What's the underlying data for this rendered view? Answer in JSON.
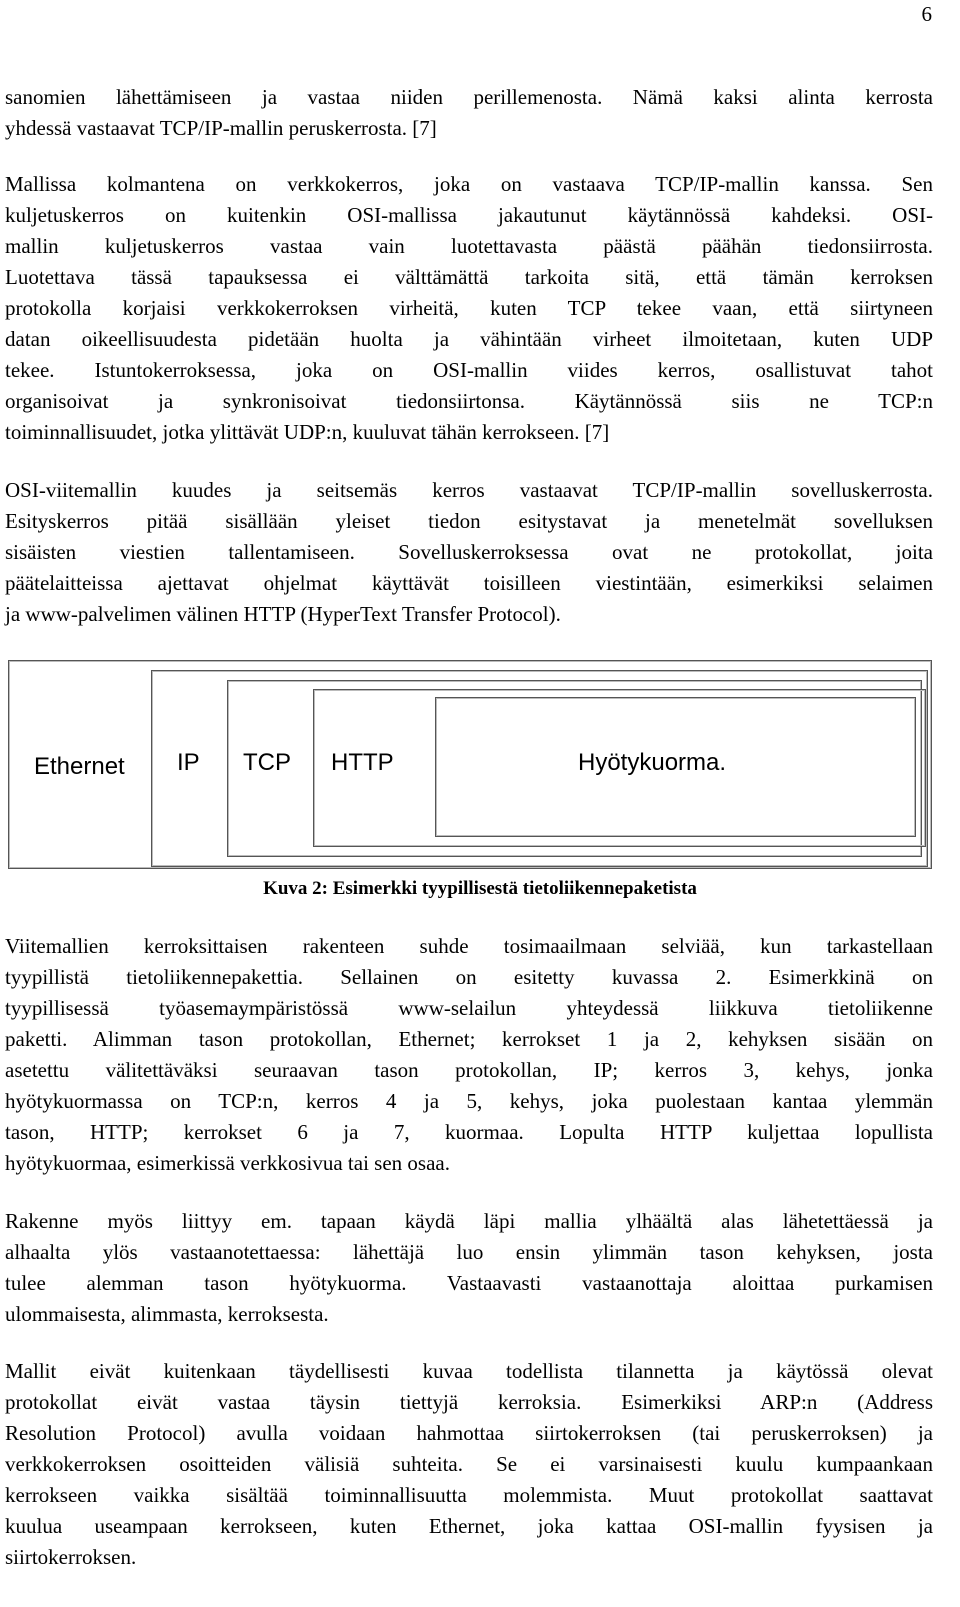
{
  "page_number": "6",
  "paragraphs": [
    {
      "lines": [
        "sanomien lähettämiseen ja vastaa niiden perillemenosta. Nämä kaksi alinta kerrosta",
        "yhdessä vastaavat TCP/IP-mallin peruskerrosta. [7]"
      ]
    },
    {
      "lines": [
        "Mallissa kolmantena on verkkokerros, joka on vastaava TCP/IP-mallin kanssa. Sen",
        "kuljetuskerros on kuitenkin OSI-mallissa jakautunut käytännössä kahdeksi. OSI-",
        "mallin kuljetuskerros vastaa vain luotettavasta päästä päähän tiedonsiirrosta.",
        "Luotettava tässä tapauksessa ei välttämättä tarkoita sitä, että tämän kerroksen",
        "protokolla korjaisi verkkokerroksen virheitä, kuten TCP tekee vaan, että siirtyneen",
        "datan oikeellisuudesta pidetään huolta ja vähintään virheet ilmoitetaan, kuten UDP",
        "tekee. Istuntokerroksessa, joka on OSI-mallin viides kerros, osallistuvat tahot",
        "organisoivat ja synkronisoivat tiedonsiirtonsa. Käytännössä siis ne TCP:n",
        "toiminnallisuudet, jotka ylittävät UDP:n, kuuluvat tähän kerrokseen. [7]"
      ]
    },
    {
      "lines": [
        "OSI-viitemallin kuudes ja seitsemäs kerros vastaavat TCP/IP-mallin sovelluskerrosta.",
        "Esityskerros pitää sisällään yleiset tiedon esitystavat ja menetelmät sovelluksen",
        "sisäisten viestien tallentamiseen. Sovelluskerroksessa ovat ne protokollat, joita",
        "päätelaitteissa ajettavat ohjelmat käyttävät toisilleen viestintään, esimerkiksi selaimen",
        "ja www-palvelimen välinen HTTP (HyperText Transfer Protocol)."
      ]
    },
    {
      "lines": [
        "Viitemallien kerroksittaisen rakenteen suhde tosimaailmaan selviää, kun tarkastellaan",
        "tyypillistä tietoliikennepakettia. Sellainen on esitetty kuvassa 2. Esimerkkinä on",
        "tyypillisessä työasemaympäristössä www-selailun yhteydessä liikkuva tietoliikenne",
        "paketti. Alimman tason protokollan, Ethernet; kerrokset 1 ja 2, kehyksen sisään on",
        "asetettu välitettäväksi seuraavan tason protokollan, IP; kerros 3, kehys, jonka",
        "hyötykuormassa on TCP:n, kerros 4 ja 5, kehys, joka puolestaan kantaa ylemmän",
        "tason, HTTP; kerrokset 6 ja 7, kuormaa. Lopulta HTTP kuljettaa lopullista",
        "hyötykuormaa, esimerkissä verkkosivua tai sen osaa."
      ]
    },
    {
      "lines": [
        " Rakenne myös liittyy em. tapaan käydä läpi mallia ylhäältä alas lähetettäessä ja",
        "alhaalta ylös vastaanotettaessa: lähettäjä luo ensin ylimmän tason kehyksen, josta",
        "tulee alemman tason hyötykuorma. Vastaavasti vastaanottaja aloittaa purkamisen",
        "ulommaisesta, alimmasta, kerroksesta."
      ]
    },
    {
      "lines": [
        "Mallit eivät kuitenkaan täydellisesti kuvaa todellista tilannetta ja käytössä olevat",
        "protokollat eivät vastaa täysin tiettyjä kerroksia. Esimerkiksi ARP:n (Address",
        "Resolution Protocol) avulla voidaan hahmottaa siirtokerroksen (tai peruskerroksen) ja",
        "verkkokerroksen osoitteiden välisiä suhteita. Se ei varsinaisesti kuulu kumpaankaan",
        "kerrokseen vaikka sisältää toiminnallisuutta molemmista. Muut protokollat saattavat",
        "kuulua useampaan kerrokseen, kuten Ethernet, joka kattaa OSI-mallin fyysisen ja",
        "siirtokerroksen."
      ]
    }
  ],
  "figure": {
    "layers": [
      "Ethernet",
      "IP",
      "TCP",
      "HTTP",
      "Hyötykuorma."
    ],
    "caption": "Kuva 2: Esimerkki tyypillisestä tietoliikennepaketista"
  }
}
